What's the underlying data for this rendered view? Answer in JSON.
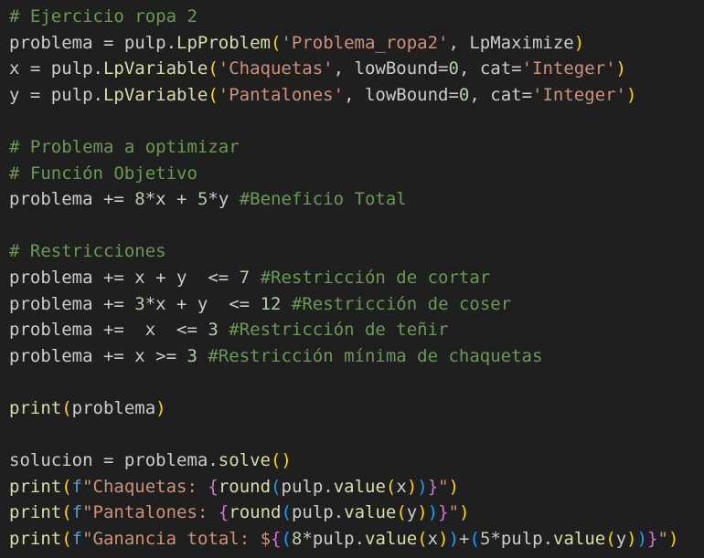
{
  "editor": {
    "language": "python",
    "colors": {
      "background": "#1f1f1f",
      "comment": "#6a9955",
      "default": "#cccccc",
      "func": "#dcdcaa",
      "string": "#ce9178",
      "number": "#b5cea8",
      "bracket1": "#ffd700",
      "bracket2": "#da70d6",
      "bracket3": "#179fff",
      "keyword": "#569cd6"
    },
    "lines": [
      [
        {
          "t": "# Ejercicio ropa 2",
          "c": "comment"
        }
      ],
      [
        {
          "t": "problema = pulp.",
          "c": "default"
        },
        {
          "t": "LpProblem",
          "c": "func"
        },
        {
          "t": "(",
          "c": "bracket1"
        },
        {
          "t": "'Problema_ropa2'",
          "c": "string"
        },
        {
          "t": ", LpMaximize",
          "c": "default"
        },
        {
          "t": ")",
          "c": "bracket1"
        }
      ],
      [
        {
          "t": "x = pulp.",
          "c": "default"
        },
        {
          "t": "LpVariable",
          "c": "func"
        },
        {
          "t": "(",
          "c": "bracket1"
        },
        {
          "t": "'Chaquetas'",
          "c": "string"
        },
        {
          "t": ", lowBound=",
          "c": "default"
        },
        {
          "t": "0",
          "c": "number"
        },
        {
          "t": ", cat=",
          "c": "default"
        },
        {
          "t": "'Integer'",
          "c": "string"
        },
        {
          "t": ")",
          "c": "bracket1"
        }
      ],
      [
        {
          "t": "y = pulp.",
          "c": "default"
        },
        {
          "t": "LpVariable",
          "c": "func"
        },
        {
          "t": "(",
          "c": "bracket1"
        },
        {
          "t": "'Pantalones'",
          "c": "string"
        },
        {
          "t": ", lowBound=",
          "c": "default"
        },
        {
          "t": "0",
          "c": "number"
        },
        {
          "t": ", cat=",
          "c": "default"
        },
        {
          "t": "'Integer'",
          "c": "string"
        },
        {
          "t": ")",
          "c": "bracket1"
        }
      ],
      [],
      [
        {
          "t": "# Problema a optimizar",
          "c": "comment"
        }
      ],
      [
        {
          "t": "# Función Objetivo",
          "c": "comment"
        }
      ],
      [
        {
          "t": "problema += ",
          "c": "default"
        },
        {
          "t": "8",
          "c": "number"
        },
        {
          "t": "*x + ",
          "c": "default"
        },
        {
          "t": "5",
          "c": "number"
        },
        {
          "t": "*y ",
          "c": "default"
        },
        {
          "t": "#Beneficio Total",
          "c": "comment"
        }
      ],
      [],
      [
        {
          "t": "# Restricciones",
          "c": "comment"
        }
      ],
      [
        {
          "t": "problema += x + y  <= ",
          "c": "default"
        },
        {
          "t": "7",
          "c": "number"
        },
        {
          "t": " ",
          "c": "default"
        },
        {
          "t": "#Restricción de cortar",
          "c": "comment"
        }
      ],
      [
        {
          "t": "problema += ",
          "c": "default"
        },
        {
          "t": "3",
          "c": "number"
        },
        {
          "t": "*x + y  <= ",
          "c": "default"
        },
        {
          "t": "12",
          "c": "number"
        },
        {
          "t": " ",
          "c": "default"
        },
        {
          "t": "#Restricción de coser",
          "c": "comment"
        }
      ],
      [
        {
          "t": "problema +=  x  <= ",
          "c": "default"
        },
        {
          "t": "3",
          "c": "number"
        },
        {
          "t": " ",
          "c": "default"
        },
        {
          "t": "#Restricción de teñir",
          "c": "comment"
        }
      ],
      [
        {
          "t": "problema += x >= ",
          "c": "default"
        },
        {
          "t": "3",
          "c": "number"
        },
        {
          "t": " ",
          "c": "default"
        },
        {
          "t": "#Restricción mínima de chaquetas",
          "c": "comment"
        }
      ],
      [],
      [
        {
          "t": "print",
          "c": "func"
        },
        {
          "t": "(",
          "c": "bracket1"
        },
        {
          "t": "problema",
          "c": "default"
        },
        {
          "t": ")",
          "c": "bracket1"
        }
      ],
      [],
      [
        {
          "t": "solucion = problema.",
          "c": "default"
        },
        {
          "t": "solve",
          "c": "func"
        },
        {
          "t": "()",
          "c": "bracket1"
        }
      ],
      [
        {
          "t": "print",
          "c": "func"
        },
        {
          "t": "(",
          "c": "bracket1"
        },
        {
          "t": "f",
          "c": "keyword"
        },
        {
          "t": "\"Chaquetas: ",
          "c": "string"
        },
        {
          "t": "{",
          "c": "bracket2"
        },
        {
          "t": "round",
          "c": "func"
        },
        {
          "t": "(",
          "c": "bracket3"
        },
        {
          "t": "pulp.",
          "c": "default"
        },
        {
          "t": "value",
          "c": "func"
        },
        {
          "t": "(",
          "c": "bracket1"
        },
        {
          "t": "x",
          "c": "default"
        },
        {
          "t": ")",
          "c": "bracket1"
        },
        {
          "t": ")",
          "c": "bracket3"
        },
        {
          "t": "}",
          "c": "bracket2"
        },
        {
          "t": "\"",
          "c": "string"
        },
        {
          "t": ")",
          "c": "bracket1"
        }
      ],
      [
        {
          "t": "print",
          "c": "func"
        },
        {
          "t": "(",
          "c": "bracket1"
        },
        {
          "t": "f",
          "c": "keyword"
        },
        {
          "t": "\"Pantalones: ",
          "c": "string"
        },
        {
          "t": "{",
          "c": "bracket2"
        },
        {
          "t": "round",
          "c": "func"
        },
        {
          "t": "(",
          "c": "bracket3"
        },
        {
          "t": "pulp.",
          "c": "default"
        },
        {
          "t": "value",
          "c": "func"
        },
        {
          "t": "(",
          "c": "bracket1"
        },
        {
          "t": "y",
          "c": "default"
        },
        {
          "t": ")",
          "c": "bracket1"
        },
        {
          "t": ")",
          "c": "bracket3"
        },
        {
          "t": "}",
          "c": "bracket2"
        },
        {
          "t": "\"",
          "c": "string"
        },
        {
          "t": ")",
          "c": "bracket1"
        }
      ],
      [
        {
          "t": "print",
          "c": "func"
        },
        {
          "t": "(",
          "c": "bracket1"
        },
        {
          "t": "f",
          "c": "keyword"
        },
        {
          "t": "\"Ganancia total: $",
          "c": "string"
        },
        {
          "t": "{",
          "c": "bracket2"
        },
        {
          "t": "(",
          "c": "bracket3"
        },
        {
          "t": "8",
          "c": "number"
        },
        {
          "t": "*pulp.",
          "c": "default"
        },
        {
          "t": "value",
          "c": "func"
        },
        {
          "t": "(",
          "c": "bracket1"
        },
        {
          "t": "x",
          "c": "default"
        },
        {
          "t": ")",
          "c": "bracket1"
        },
        {
          "t": ")",
          "c": "bracket3"
        },
        {
          "t": "+",
          "c": "default"
        },
        {
          "t": "(",
          "c": "bracket3"
        },
        {
          "t": "5",
          "c": "number"
        },
        {
          "t": "*pulp.",
          "c": "default"
        },
        {
          "t": "value",
          "c": "func"
        },
        {
          "t": "(",
          "c": "bracket1"
        },
        {
          "t": "y",
          "c": "default"
        },
        {
          "t": ")",
          "c": "bracket1"
        },
        {
          "t": ")",
          "c": "bracket3"
        },
        {
          "t": "}",
          "c": "bracket2"
        },
        {
          "t": "\"",
          "c": "string"
        },
        {
          "t": ")",
          "c": "bracket1"
        }
      ]
    ]
  }
}
